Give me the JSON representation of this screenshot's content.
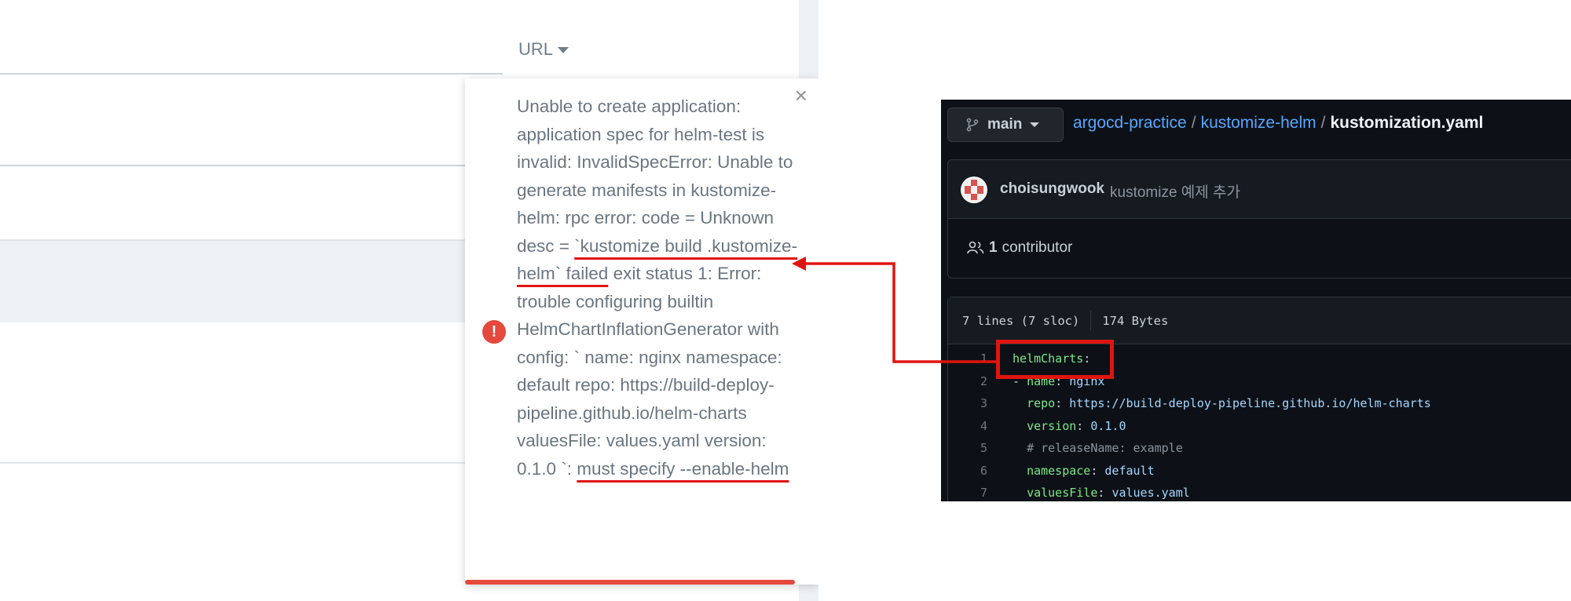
{
  "argocd": {
    "url_dropdown_label": "URL",
    "notification": {
      "close_symbol": "×",
      "icon_symbol": "!",
      "seg1": "Unable to create application: application spec for helm-test is invalid: InvalidSpecError: Unable to generate manifests in kustomize-helm: rpc error: code = Unknown desc = ",
      "seg2": "`kustomize build .kustomize-helm` failed",
      "seg3": " exit status 1: Error: trouble configuring builtin HelmChartInflationGenerator with config: ` name: nginx namespace: default repo: https://build-deploy-pipeline.github.io/helm-charts valuesFile: values.yaml version: 0.1.0 `: ",
      "seg4": "must specify --enable-helm"
    }
  },
  "github": {
    "branch": "main",
    "breadcrumb": {
      "repo": "argocd-practice",
      "folder": "kustomize-helm",
      "file": "kustomization.yaml",
      "separator": "/"
    },
    "commit": {
      "author": "choisungwook",
      "message": "kustomize 예제 추가"
    },
    "contributors": {
      "count": "1",
      "label": "contributor"
    },
    "file_info": {
      "lines": "7 lines (7 sloc)",
      "size": "174 Bytes"
    },
    "code": [
      {
        "n": "1",
        "indent": "",
        "dash": "",
        "key": "helmCharts",
        "colon": ":",
        "val": "",
        "comment": ""
      },
      {
        "n": "2",
        "indent": "",
        "dash": "- ",
        "key": "name",
        "colon": ": ",
        "val": "nginx",
        "comment": ""
      },
      {
        "n": "3",
        "indent": "  ",
        "dash": "",
        "key": "repo",
        "colon": ": ",
        "val": "https://build-deploy-pipeline.github.io/helm-charts",
        "comment": ""
      },
      {
        "n": "4",
        "indent": "  ",
        "dash": "",
        "key": "version",
        "colon": ": ",
        "val": "0.1.0",
        "comment": ""
      },
      {
        "n": "5",
        "indent": "  ",
        "dash": "",
        "key": "",
        "colon": "",
        "val": "",
        "comment": "# releaseName: example"
      },
      {
        "n": "6",
        "indent": "  ",
        "dash": "",
        "key": "namespace",
        "colon": ": ",
        "val": "default",
        "comment": ""
      },
      {
        "n": "7",
        "indent": "  ",
        "dash": "",
        "key": "valuesFile",
        "colon": ": ",
        "val": "values.yaml",
        "comment": ""
      }
    ]
  },
  "colors": {
    "annotation_red": "#e0140f",
    "error_red": "#e5483c",
    "github_bg": "#0d1117",
    "link_blue": "#58a6ff",
    "yaml_key": "#7ee787",
    "yaml_value": "#a5d6ff"
  },
  "icons": [
    "caret-down-icon",
    "close-icon",
    "error-icon",
    "git-branch-icon",
    "people-icon",
    "arrow-annotation"
  ]
}
